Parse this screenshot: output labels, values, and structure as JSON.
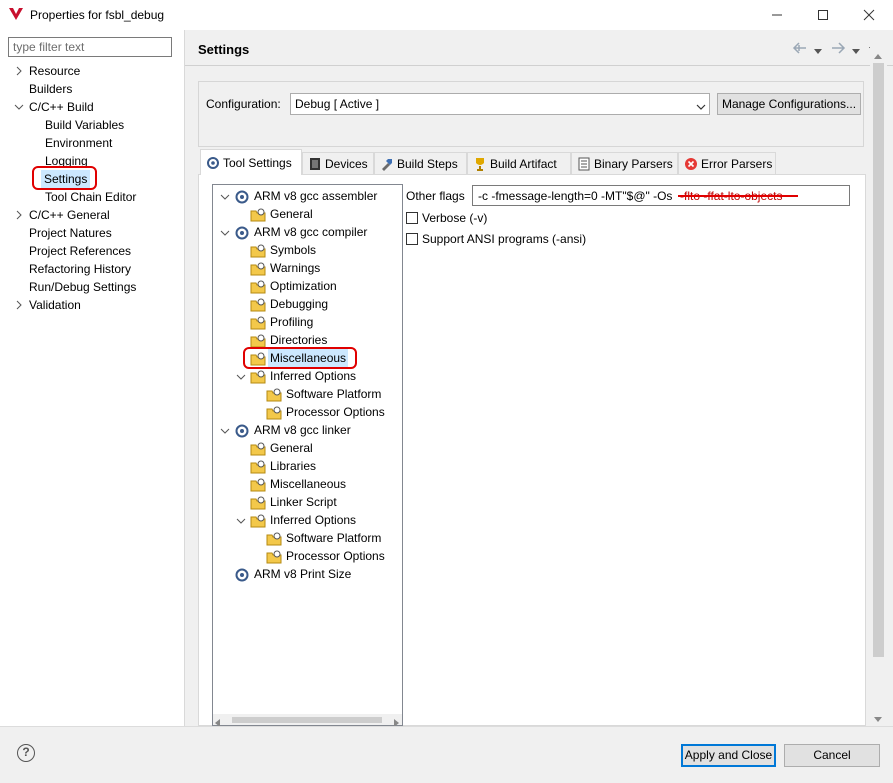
{
  "window": {
    "title": "Properties for fsbl_debug"
  },
  "filter": {
    "placeholder": "type filter text"
  },
  "nav": [
    {
      "label": "Resource"
    },
    {
      "label": "Builders"
    },
    {
      "label": "C/C++ Build"
    },
    {
      "label": "Build Variables"
    },
    {
      "label": "Environment"
    },
    {
      "label": "Logging"
    },
    {
      "label": "Settings"
    },
    {
      "label": "Tool Chain Editor"
    },
    {
      "label": "C/C++ General"
    },
    {
      "label": "Project Natures"
    },
    {
      "label": "Project References"
    },
    {
      "label": "Refactoring History"
    },
    {
      "label": "Run/Debug Settings"
    },
    {
      "label": "Validation"
    }
  ],
  "page": {
    "title": "Settings"
  },
  "config": {
    "label": "Configuration:",
    "value": "Debug  [ Active ]",
    "manage_button": "Manage Configurations..."
  },
  "tabs": [
    {
      "label": "Tool Settings"
    },
    {
      "label": "Devices"
    },
    {
      "label": "Build Steps"
    },
    {
      "label": "Build Artifact"
    },
    {
      "label": "Binary Parsers"
    },
    {
      "label": "Error Parsers"
    }
  ],
  "tree": [
    {
      "label": "ARM v8 gcc assembler"
    },
    {
      "label": "General"
    },
    {
      "label": "ARM v8 gcc compiler"
    },
    {
      "label": "Symbols"
    },
    {
      "label": "Warnings"
    },
    {
      "label": "Optimization"
    },
    {
      "label": "Debugging"
    },
    {
      "label": "Profiling"
    },
    {
      "label": "Directories"
    },
    {
      "label": "Miscellaneous"
    },
    {
      "label": "Inferred Options"
    },
    {
      "label": "Software Platform"
    },
    {
      "label": "Processor Options"
    },
    {
      "label": "ARM v8 gcc linker"
    },
    {
      "label": "General"
    },
    {
      "label": "Libraries"
    },
    {
      "label": "Miscellaneous"
    },
    {
      "label": "Linker Script"
    },
    {
      "label": "Inferred Options"
    },
    {
      "label": "Software Platform"
    },
    {
      "label": "Processor Options"
    },
    {
      "label": "ARM v8 Print Size"
    }
  ],
  "details": {
    "other_flags_label": "Other flags",
    "other_flags_value": "-c -fmessage-length=0 -MT\"$@\" -Os",
    "other_flags_struck": "-flto -ffat-lto-objects",
    "verbose_label": "Verbose (-v)",
    "ansi_label": "Support ANSI programs (-ansi)"
  },
  "buttons": {
    "help": "?",
    "apply": "Apply and Close",
    "cancel": "Cancel"
  },
  "colors": {
    "highlight": "#e00000",
    "accent": "#0078d7"
  }
}
